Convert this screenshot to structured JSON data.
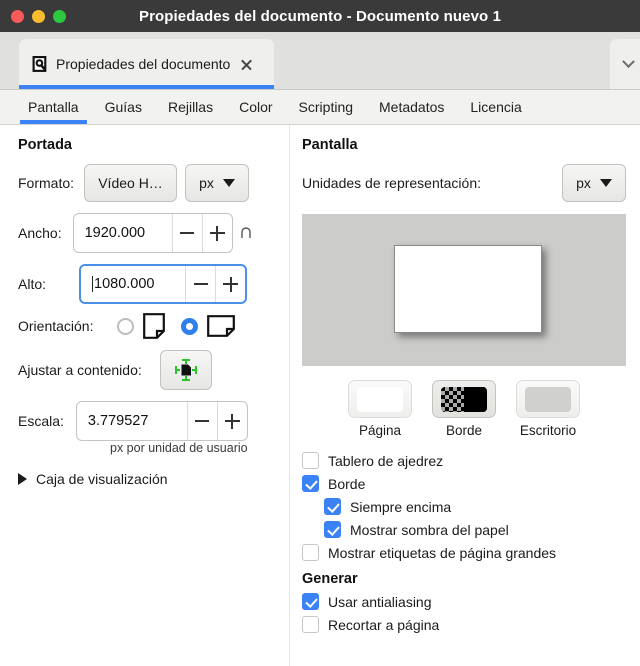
{
  "window": {
    "title": "Propiedades del documento - Documento nuevo 1",
    "traffic_lights": [
      "close-button",
      "minimize-button",
      "maximize-button"
    ],
    "colors": {
      "titlebar": "#3a3a3a",
      "accent": "#3b82f6",
      "red": "#f8595a",
      "yellow": "#f9bd2e",
      "green": "#2dc840"
    }
  },
  "doc_tab": {
    "label": "Propiedades del documento",
    "icon": "document-properties-icon",
    "close_icon": "close-icon",
    "overflow_icon": "chevron-down-icon"
  },
  "section_tabs": [
    {
      "label": "Pantalla",
      "active": true
    },
    {
      "label": "Guías",
      "active": false
    },
    {
      "label": "Rejillas",
      "active": false
    },
    {
      "label": "Color",
      "active": false
    },
    {
      "label": "Scripting",
      "active": false
    },
    {
      "label": "Metadatos",
      "active": false
    },
    {
      "label": "Licencia",
      "active": false
    }
  ],
  "left": {
    "heading": "Portada",
    "formato_label": "Formato:",
    "formato_value": "Vídeo H…",
    "formato_unit": "px",
    "ancho_label": "Ancho:",
    "ancho_value": "1920.000",
    "alto_label": "Alto:",
    "alto_value": "1080.000",
    "minus_icon": "minus-icon",
    "plus_icon": "plus-icon",
    "link_icon": "broken-link-icon",
    "orientacion_label": "Orientación:",
    "orientacion_portrait": "portrait-page-icon",
    "orientacion_landscape": "landscape-page-icon",
    "orientacion_selected": "landscape",
    "ajustar_label": "Ajustar a contenido:",
    "ajustar_icon": "fit-to-content-icon",
    "escala_label": "Escala:",
    "escala_value": "3.779527",
    "escala_hint": "px por unidad de usuario",
    "caja_label": "Caja de visualización",
    "caja_icon": "disclosure-triangle-icon"
  },
  "right": {
    "heading": "Pantalla",
    "unidades_label": "Unidades de representación:",
    "unidades_value": "px",
    "preview_desktop_color": "#ccccca",
    "preview_page_color": "#ffffff",
    "swatches": [
      {
        "label": "Página",
        "kind": "white",
        "selected": false
      },
      {
        "label": "Borde",
        "kind": "border",
        "selected": true
      },
      {
        "label": "Escritorio",
        "kind": "desktop",
        "selected": false
      }
    ],
    "checkboxes": [
      {
        "label": "Tablero de ajedrez",
        "checked": false,
        "indent": false
      },
      {
        "label": "Borde",
        "checked": true,
        "indent": false
      },
      {
        "label": "Siempre encima",
        "checked": true,
        "indent": true
      },
      {
        "label": "Mostrar sombra del papel",
        "checked": true,
        "indent": true
      },
      {
        "label": "Mostrar etiquetas de página grandes",
        "checked": false,
        "indent": false
      }
    ],
    "generar_heading": "Generar",
    "generar_checkboxes": [
      {
        "label": "Usar antialiasing",
        "checked": true
      },
      {
        "label": "Recortar a página",
        "checked": false
      }
    ]
  }
}
